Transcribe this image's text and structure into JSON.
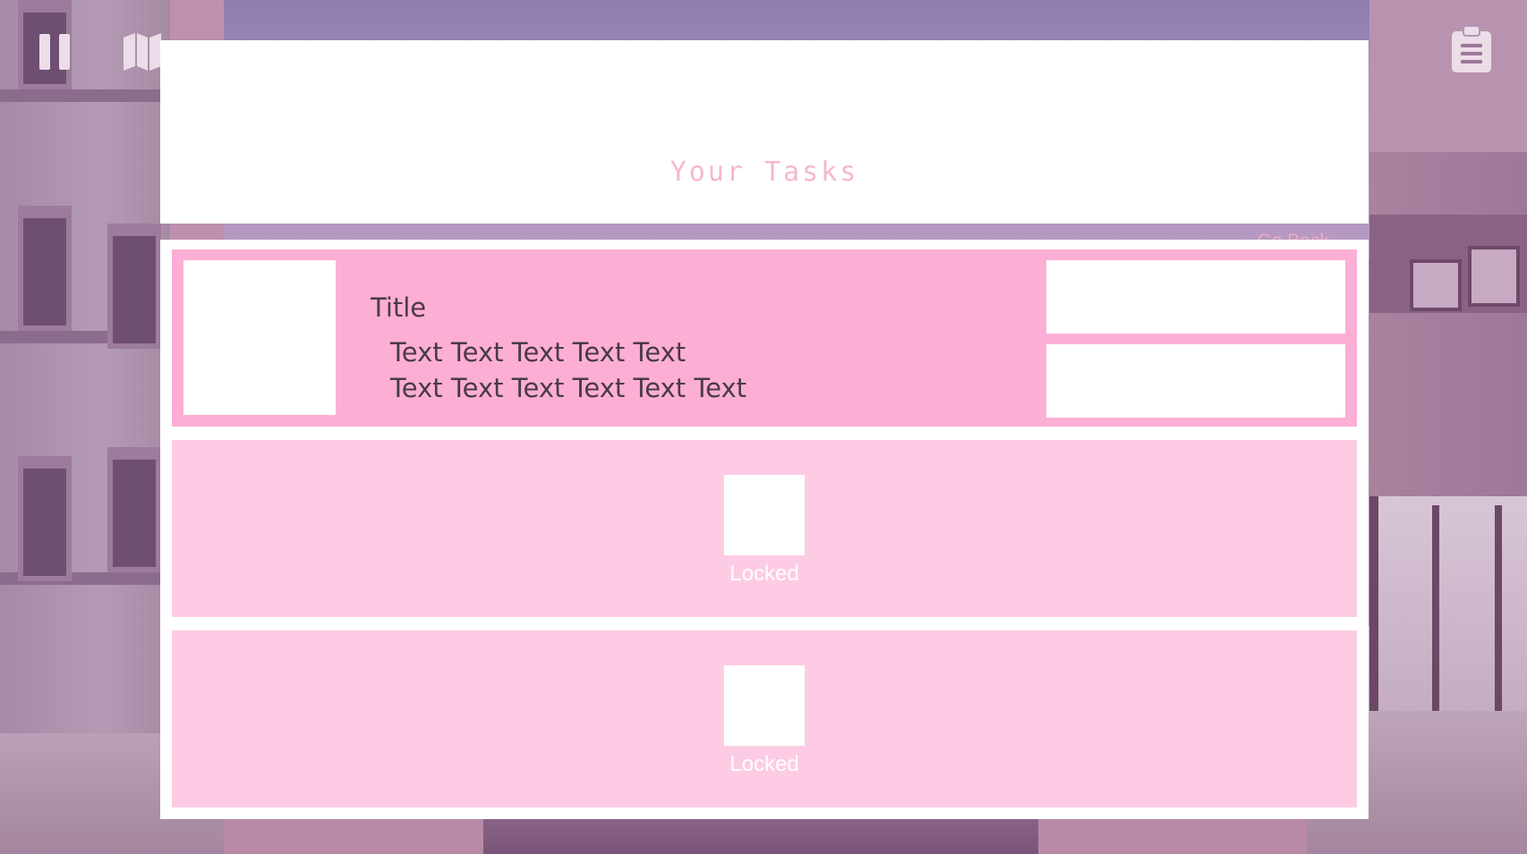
{
  "header": {
    "title": "Your Tasks",
    "go_back_label": "Go Back"
  },
  "hud": {
    "pause_icon": "pause-icon",
    "map_icon": "map-icon",
    "tasks_icon": "clipboard-icon"
  },
  "tasks": [
    {
      "state": "unlocked",
      "title": "Title",
      "description": "Text Text Text Text Text\nText Text Text Text Text Text"
    },
    {
      "state": "locked",
      "label": "Locked"
    },
    {
      "state": "locked",
      "label": "Locked"
    }
  ],
  "colors": {
    "active_card": "#fdaed4",
    "locked_card": "#fdcce4",
    "title_pink": "#f6b6d0",
    "panel": "#ffffff"
  }
}
